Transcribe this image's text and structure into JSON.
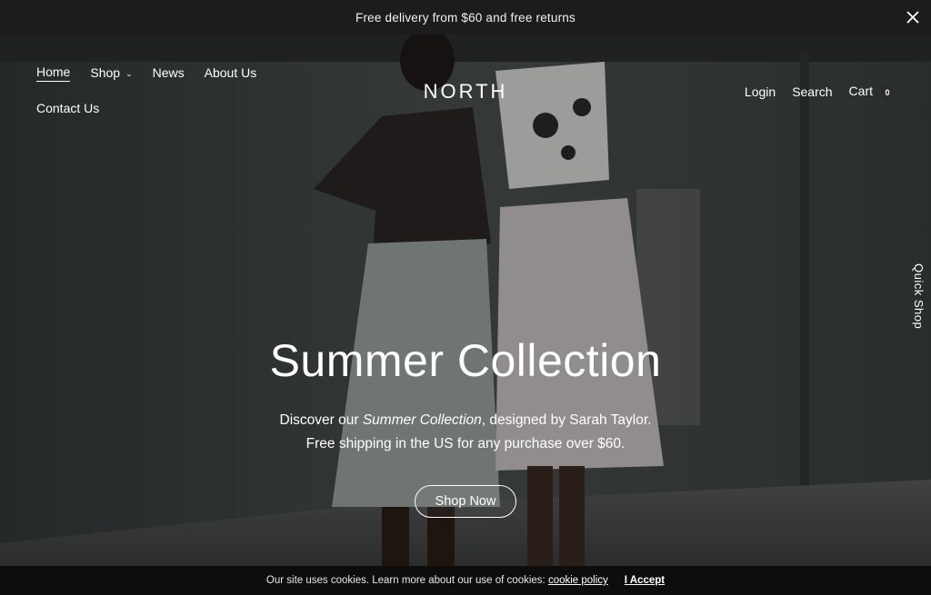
{
  "announcement": {
    "text": "Free delivery from $60 and free returns",
    "close_icon": "close-icon"
  },
  "nav": {
    "left": [
      {
        "label": "Home",
        "active": true
      },
      {
        "label": "Shop",
        "has_dropdown": true
      },
      {
        "label": "News"
      },
      {
        "label": "About Us"
      },
      {
        "label": "Contact Us"
      }
    ],
    "logo": "NORTH",
    "right": {
      "login": "Login",
      "search": "Search",
      "cart": "Cart",
      "cart_count": "0"
    }
  },
  "quick_shop": "Quick Shop",
  "hero": {
    "title": "Summer Collection",
    "line1_prefix": "Discover our ",
    "line1_em": "Summer Collection",
    "line1_suffix": ", designed by Sarah Taylor.",
    "line2": "Free shipping in the US for any purchase over $60.",
    "button": "Shop Now"
  },
  "cookie": {
    "text": "Our site uses cookies. Learn more about our use of cookies: ",
    "policy_link": "cookie policy",
    "accept": "I Accept"
  },
  "colors": {
    "announcement_bg": "#1c1c1c",
    "cookie_bg": "#0d0d0d",
    "hero_wall": "#3a403f"
  }
}
